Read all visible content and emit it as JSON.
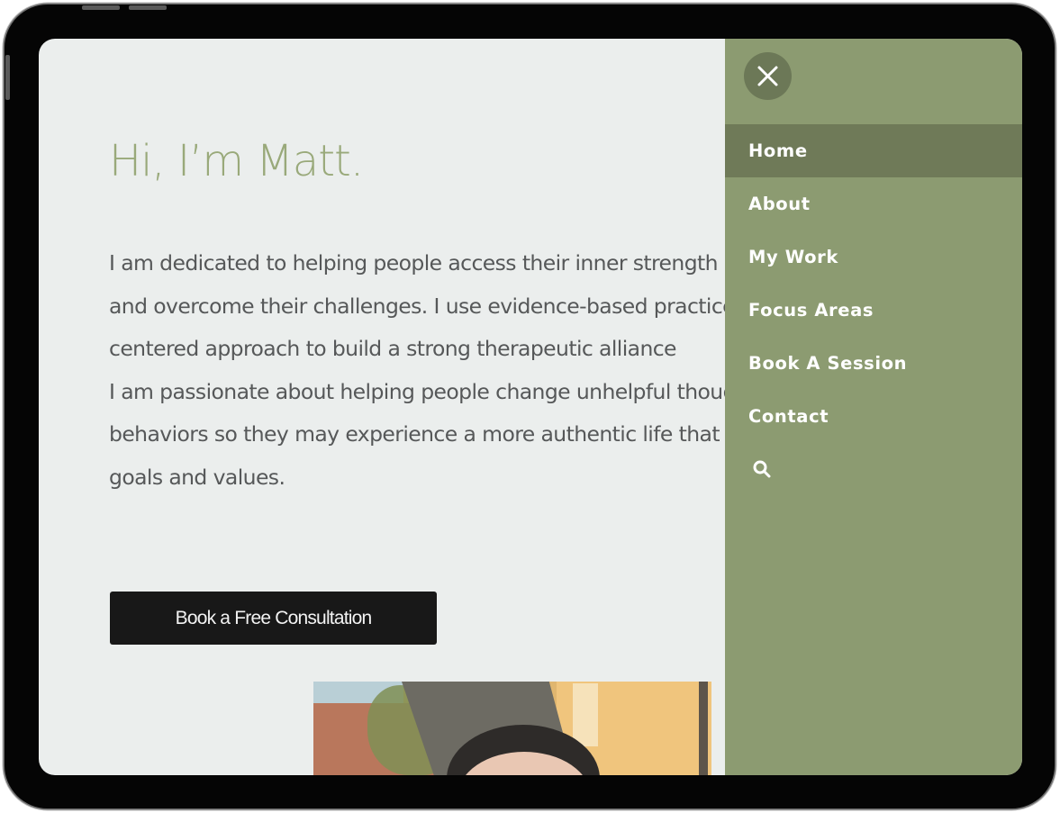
{
  "page": {
    "greeting": "Hi, I’m Matt.",
    "intro_lines": [
      "I am dedicated to helping people access their inner strength",
      "and overcome their challenges. I use evidence-based practices",
      "centered approach to build a strong therapeutic alliance",
      "I am passionate about helping people change unhelpful thoughts",
      "behaviors so they may experience a more authentic life that",
      "goals and values."
    ],
    "cta_label": "Book a Free Consultation"
  },
  "nav": {
    "items": [
      {
        "label": "Home",
        "active": true
      },
      {
        "label": "About",
        "active": false
      },
      {
        "label": "My Work",
        "active": false
      },
      {
        "label": "Focus Areas",
        "active": false
      },
      {
        "label": "Book A Session",
        "active": false
      },
      {
        "label": "Contact",
        "active": false
      }
    ],
    "close_icon": "close-icon",
    "search_icon": "search-icon"
  },
  "colors": {
    "greeting": "#99a97a",
    "drawer_background": "#8c9b71",
    "drawer_active_item": "#6f7a58",
    "close_button": "#6c7857",
    "cta_background": "#181818",
    "page_background": "#ebeeed"
  }
}
